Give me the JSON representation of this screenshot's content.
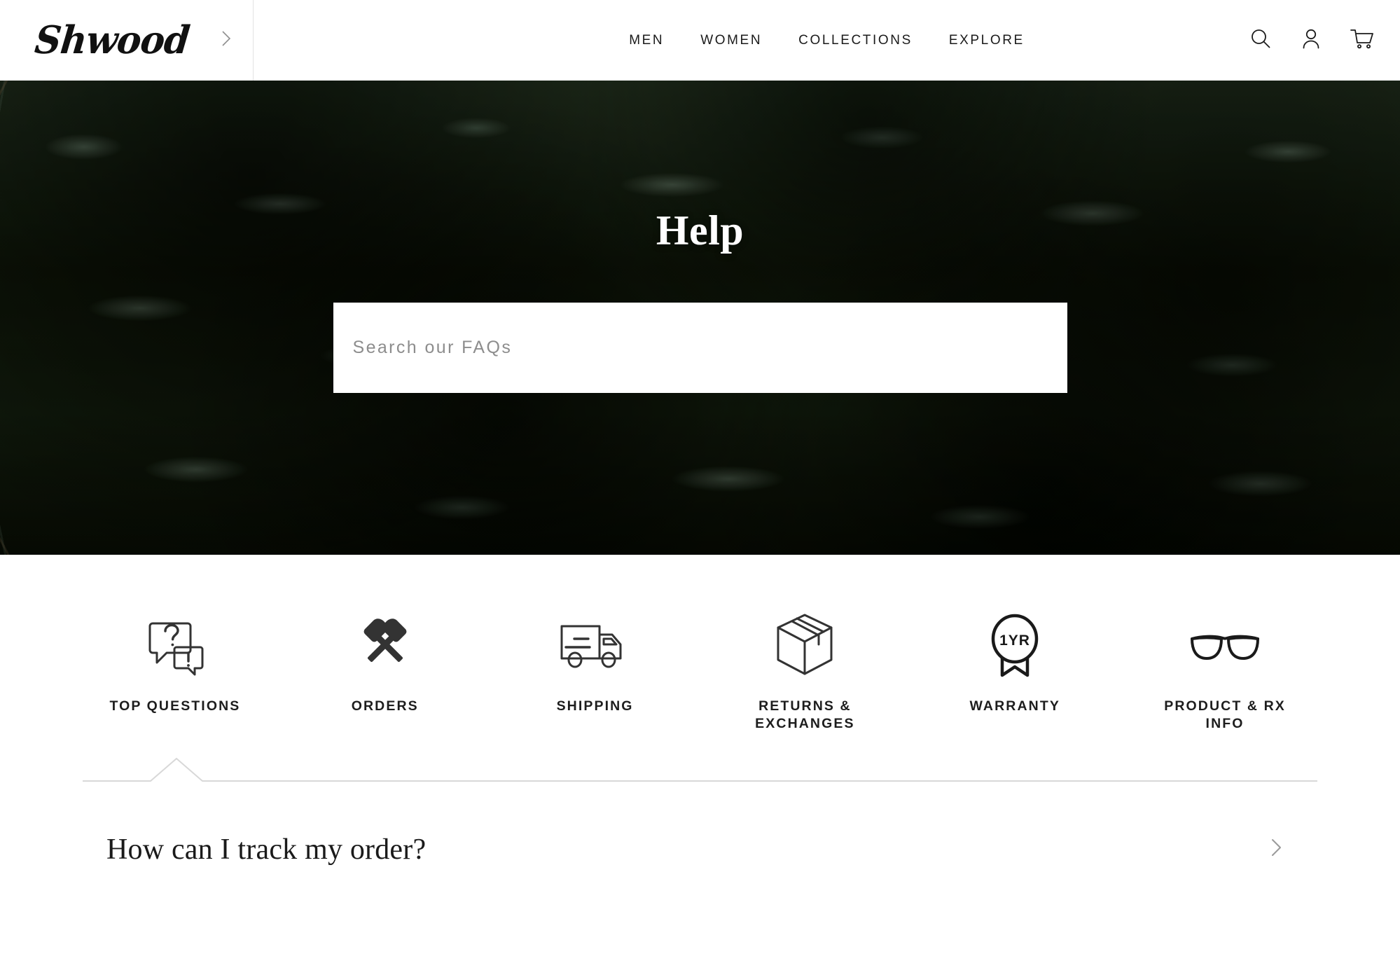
{
  "header": {
    "logo_text": "Shwood",
    "brand_chevron_icon": "chevron-right-icon",
    "nav": [
      {
        "label": "MEN"
      },
      {
        "label": "WOMEN"
      },
      {
        "label": "COLLECTIONS"
      },
      {
        "label": "EXPLORE"
      }
    ],
    "utility": [
      {
        "icon": "search-icon"
      },
      {
        "icon": "account-icon"
      },
      {
        "icon": "cart-icon"
      }
    ]
  },
  "hero": {
    "title": "Help",
    "background_description": "evergreen-spruce-branches-photo",
    "search": {
      "placeholder": "Search our FAQs",
      "value": ""
    }
  },
  "categories": {
    "active_index": 0,
    "items": [
      {
        "label": "TOP QUESTIONS",
        "icon": "question-exclamation-speech-bubbles-icon"
      },
      {
        "label": "ORDERS",
        "icon": "crossed-axes-icon"
      },
      {
        "label": "SHIPPING",
        "icon": "delivery-truck-icon"
      },
      {
        "label": "RETURNS &\nEXCHANGES",
        "icon": "shipping-box-icon"
      },
      {
        "label": "WARRANTY",
        "icon": "warranty-badge-1yr-icon",
        "badge_text": "1YR"
      },
      {
        "label": "PRODUCT & RX\nINFO",
        "icon": "sunglasses-icon"
      }
    ]
  },
  "faqs": [
    {
      "question": "How can I track my order?",
      "chevron_icon": "chevron-right-icon"
    }
  ],
  "colors": {
    "text": "#1b1b1b",
    "muted": "#8d8d8d",
    "rule": "#d8d8d8",
    "divider": "#e3e3e3",
    "hero_dark_green": "#16200f",
    "hero_sage": "#7a9a80",
    "hero_branch_brown": "#8a7050",
    "white": "#ffffff"
  }
}
